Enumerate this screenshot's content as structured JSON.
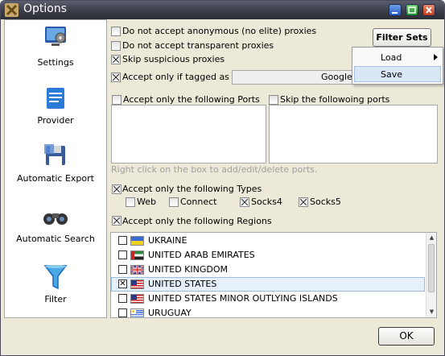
{
  "window": {
    "title": "Options"
  },
  "sidebar": {
    "items": [
      {
        "label": "Settings",
        "icon": "settings-icon"
      },
      {
        "label": "Provider",
        "icon": "provider-icon"
      },
      {
        "label": "Automatic Export",
        "icon": "floppy-disk-icon"
      },
      {
        "label": "Automatic Search",
        "icon": "binoculars-icon"
      },
      {
        "label": "Filter",
        "icon": "funnel-icon"
      }
    ]
  },
  "filters": {
    "no_anonymous": {
      "label": "Do not accept anonymous (no elite) proxies",
      "checked": false
    },
    "no_transparent": {
      "label": "Do not accept transparent proxies",
      "checked": false
    },
    "skip_suspicious": {
      "label": "Skip suspicious proxies",
      "checked": true
    },
    "tagged_as": {
      "label": "Accept only if tagged as",
      "checked": true,
      "value": "Google"
    },
    "filter_sets_label": "Filter Sets"
  },
  "filter_sets_menu": {
    "load": "Load",
    "save": "Save"
  },
  "ports": {
    "accept_label": "Accept only the following Ports",
    "skip_label": "Skip the followoing ports",
    "hint": "Right click on the box to add/edit/delete ports."
  },
  "types": {
    "label": "Accept only the following Types",
    "options": [
      {
        "label": "Web",
        "checked": false
      },
      {
        "label": "Connect",
        "checked": false
      },
      {
        "label": "Socks4",
        "checked": true
      },
      {
        "label": "Socks5",
        "checked": true
      }
    ]
  },
  "regions": {
    "label": "Accept only the following Regions",
    "items": [
      {
        "name": "UKRAINE",
        "checked": false,
        "mark": ""
      },
      {
        "name": "UNITED ARAB EMIRATES",
        "checked": false,
        "mark": ""
      },
      {
        "name": "UNITED KINGDOM",
        "checked": false,
        "mark": ""
      },
      {
        "name": "UNITED STATES",
        "checked": true,
        "mark": "✕"
      },
      {
        "name": "UNITED STATES MINOR OUTLYING ISLANDS",
        "checked": false,
        "mark": ""
      },
      {
        "name": "URUGUAY",
        "checked": false,
        "mark": ""
      }
    ]
  },
  "footer": {
    "ok_label": "OK"
  }
}
